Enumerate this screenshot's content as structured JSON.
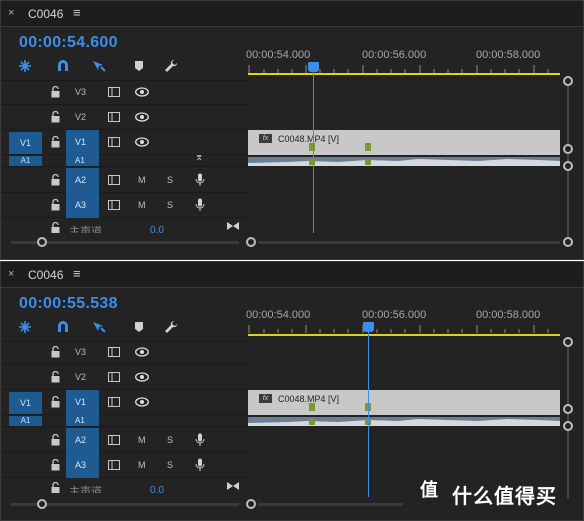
{
  "panels": [
    {
      "tab": {
        "title": "C0046"
      },
      "timecode": "00:00:54.600",
      "ruler": {
        "labels": [
          "00:00:54.000",
          "00:00:56.000",
          "00:00:58.000"
        ]
      },
      "tracks": [
        {
          "source": "",
          "target": "V3",
          "target_active": false,
          "type": "video"
        },
        {
          "source": "",
          "target": "V2",
          "target_active": false,
          "type": "video"
        },
        {
          "source": "V1",
          "target": "V1",
          "target_active": true,
          "type": "video"
        },
        {
          "source": "A1",
          "target": "A1",
          "target_active": true,
          "type": "audio-collapsed"
        },
        {
          "source": "",
          "target": "A2",
          "target_active": true,
          "type": "audio",
          "mute": "M",
          "solo": "S"
        },
        {
          "source": "",
          "target": "A3",
          "target_active": true,
          "type": "audio",
          "mute": "M",
          "solo": "S"
        }
      ],
      "master": {
        "label": "主声道",
        "value": "0.0"
      },
      "clip": {
        "name": "C0048.MP4 [V]",
        "fx": "fx"
      },
      "playhead_time_fraction": 0.215
    },
    {
      "tab": {
        "title": "C0046"
      },
      "timecode": "00:00:55.538",
      "ruler": {
        "labels": [
          "00:00:54.000",
          "00:00:56.000",
          "00:00:58.000"
        ]
      },
      "tracks": [
        {
          "source": "",
          "target": "V3",
          "target_active": false,
          "type": "video"
        },
        {
          "source": "",
          "target": "V2",
          "target_active": false,
          "type": "video"
        },
        {
          "source": "V1",
          "target": "V1",
          "target_active": true,
          "type": "video"
        },
        {
          "source": "A1",
          "target": "A1",
          "target_active": true,
          "type": "audio-collapsed"
        },
        {
          "source": "",
          "target": "A2",
          "target_active": true,
          "type": "audio",
          "mute": "M",
          "solo": "S"
        },
        {
          "source": "",
          "target": "A3",
          "target_active": true,
          "type": "audio",
          "mute": "M",
          "solo": "S"
        }
      ],
      "master": {
        "label": "主声道",
        "value": "0.0"
      },
      "clip": {
        "name": "C0048.MP4 [V]",
        "fx": "fx"
      },
      "playhead_time_fraction": 0.385
    }
  ],
  "icons": {
    "close": "×",
    "menu": "≡",
    "tools": [
      "snap-nest-icon",
      "magnet-snap-icon",
      "linked-selection-icon",
      "add-marker-icon",
      "wrench-settings-icon"
    ]
  },
  "colors": {
    "accent": "#3d8eea",
    "work_area": "#e5d11a",
    "track_patch": "#1f5b93",
    "clip": "#c8c8c8",
    "marker": "#7a9a30"
  },
  "watermark": {
    "badge": "值",
    "text": "什么值得买"
  }
}
